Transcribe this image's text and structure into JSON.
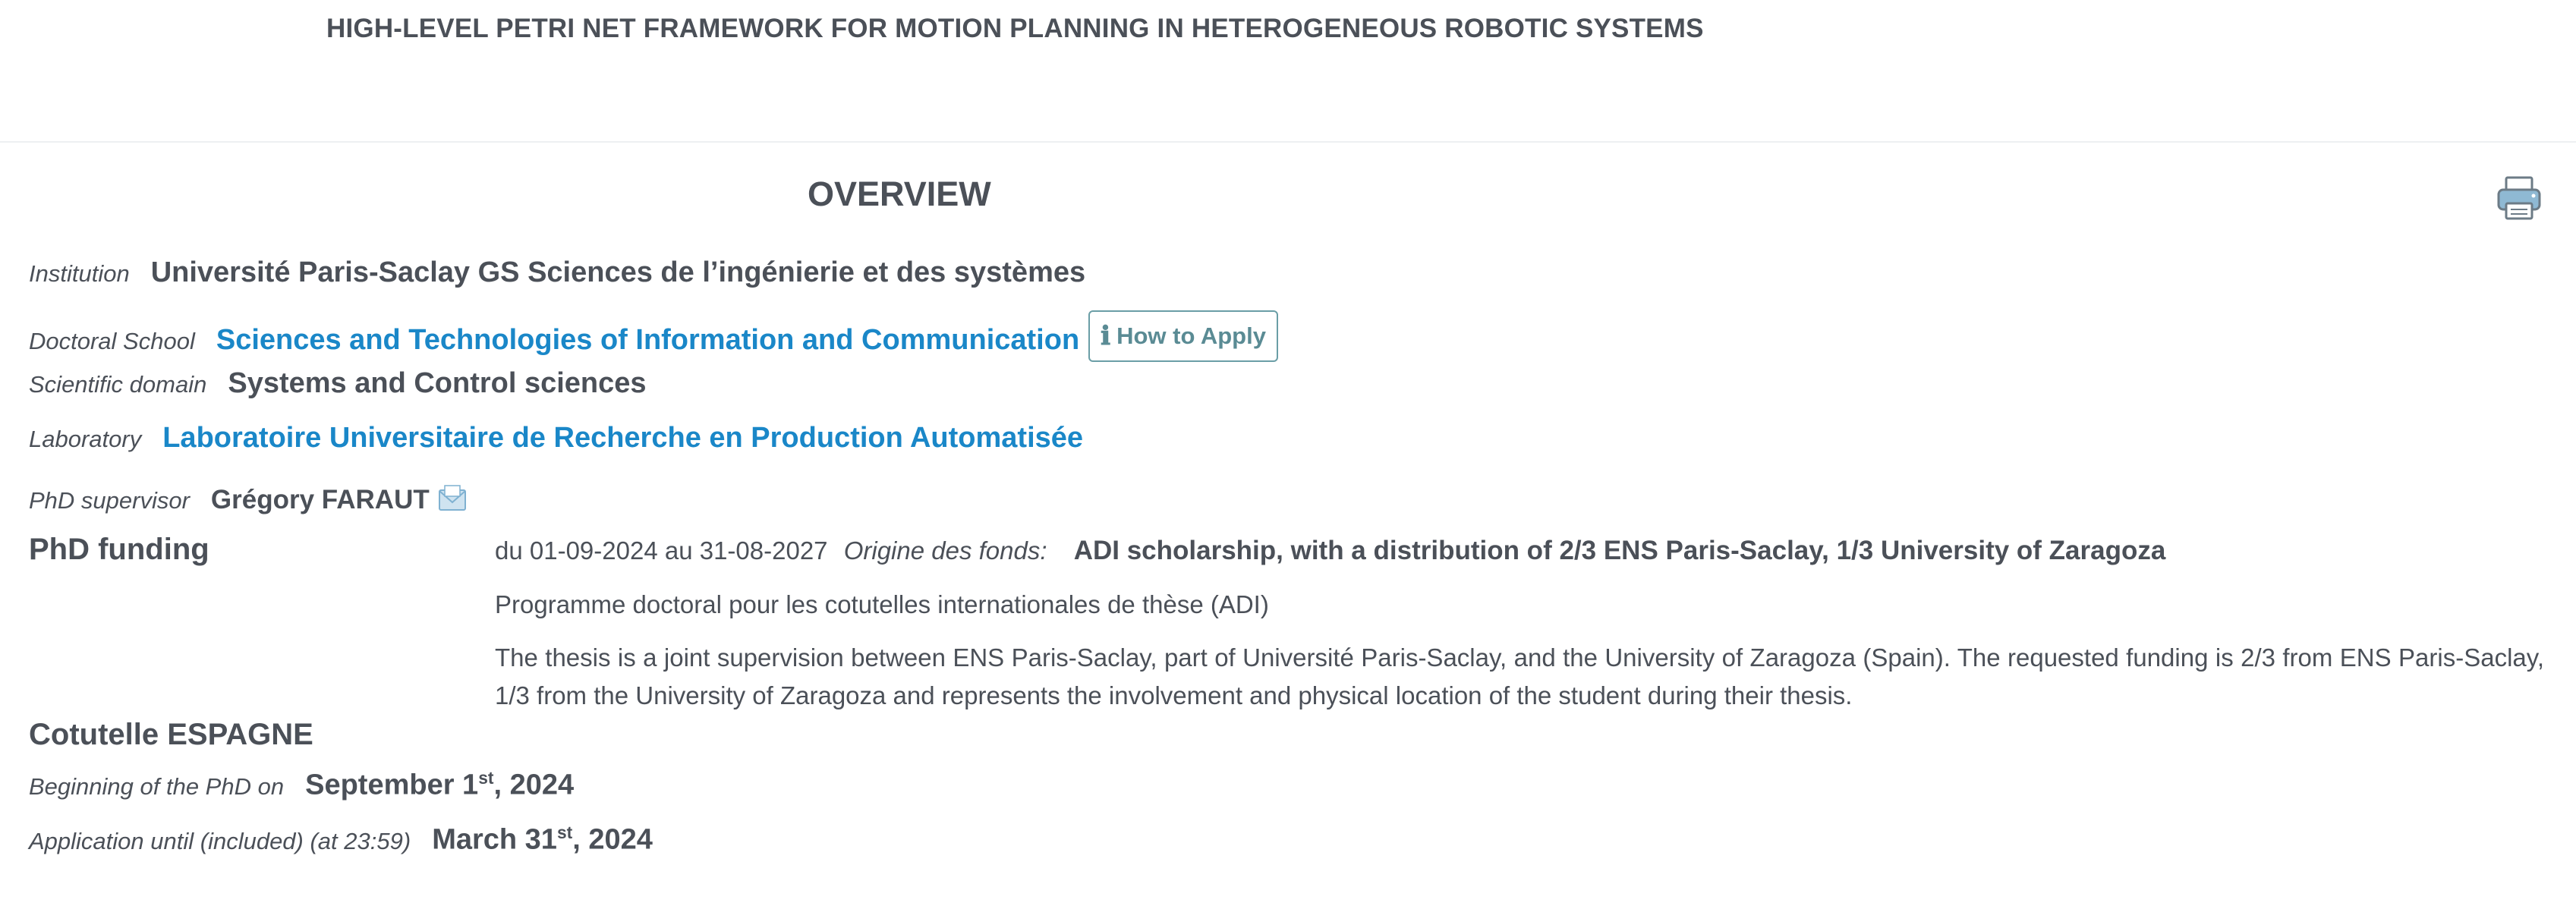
{
  "header": {
    "title": "HIGH-LEVEL PETRI NET FRAMEWORK FOR MOTION PLANNING IN HETEROGENEOUS ROBOTIC SYSTEMS"
  },
  "overview": {
    "title": "OVERVIEW",
    "print_icon": "printer-icon"
  },
  "institution": {
    "label": "Institution",
    "value": "Université Paris-Saclay GS Sciences de l’ingénierie et des systèmes"
  },
  "doctoral_school": {
    "label": "Doctoral School",
    "value": "Sciences and Technologies of Information and Communication",
    "apply_label": "How to Apply",
    "apply_icon": "info-icon"
  },
  "scientific_domain": {
    "label": "Scientific domain",
    "value": "Systems and Control sciences"
  },
  "laboratory": {
    "label": "Laboratory",
    "value": "Laboratoire Universitaire de Recherche en Production Automatisée"
  },
  "supervisor": {
    "label": "PhD supervisor",
    "value": "Grégory FARAUT",
    "contact_icon": "mail-icon"
  },
  "funding": {
    "heading": "PhD funding",
    "period": "du 01-09-2024 au 31-08-2027",
    "origin_label": "Origine des fonds:",
    "origin_value": "ADI scholarship, with a distribution of 2/3 ENS Paris-Saclay, 1/3 University of Zaragoza",
    "programme": "Programme doctoral pour les cotutelles internationales de thèse (ADI)",
    "description": "The thesis is a joint supervision between ENS Paris-Saclay, part of Université Paris-Saclay, and the University of Zaragoza (Spain). The requested funding is 2/3 from ENS Paris-Saclay, 1/3 from the University of Zaragoza and represents the involvement and physical location of the student during their thesis."
  },
  "cotutelle": {
    "heading": "Cotutelle ESPAGNE"
  },
  "beginning": {
    "label": "Beginning of the PhD on",
    "value_main": "September 1",
    "value_sup": "st",
    "value_end": ", 2024"
  },
  "application": {
    "label": "Application until (included) (at 23:59)",
    "value_main": "March 31",
    "value_sup": "st",
    "value_end": ", 2024"
  },
  "colors": {
    "text": "#4b5058",
    "link": "#1a87c8",
    "button_border": "#6a9ea6"
  }
}
